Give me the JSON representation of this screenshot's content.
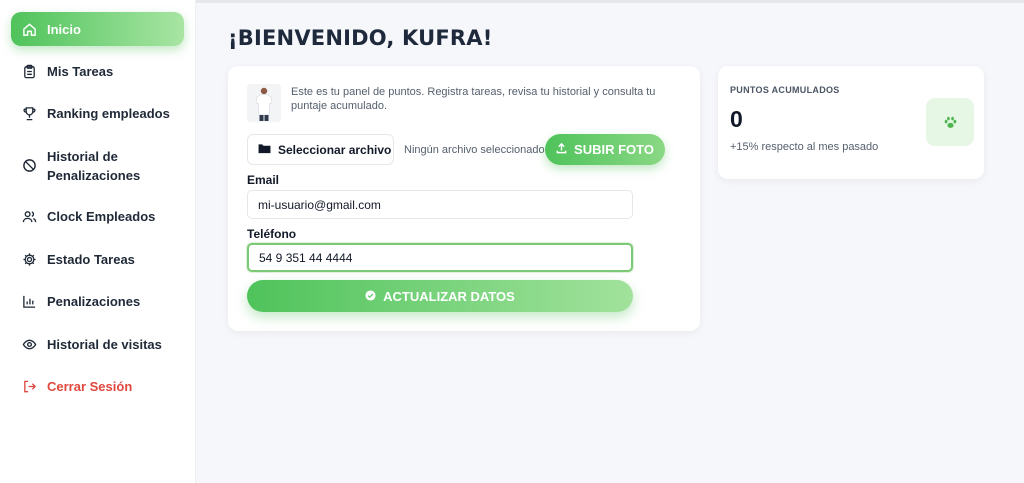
{
  "sidebar": {
    "items": [
      {
        "label": "Inicio",
        "icon": "home-icon"
      },
      {
        "label": "Mis Tareas",
        "icon": "clipboard-icon"
      },
      {
        "label": "Ranking empleados",
        "icon": "trophy-icon"
      },
      {
        "label": "Historial de Penalizaciones",
        "icon": "ban-icon"
      },
      {
        "label": "Clock Empleados",
        "icon": "users-icon"
      },
      {
        "label": "Estado Tareas",
        "icon": "gear-icon"
      },
      {
        "label": "Penalizaciones",
        "icon": "bar-chart-icon"
      },
      {
        "label": "Historial de visitas",
        "icon": "eye-icon"
      },
      {
        "label": "Cerrar Sesión",
        "icon": "logout-icon"
      }
    ],
    "active_index": 0
  },
  "main": {
    "title": "¡BIENVENIDO, KUFRA!",
    "intro": "Este es tu panel de puntos. Registra tareas, revisa tu historial y consulta tu puntaje acumulado.",
    "file_button_label": "Seleccionar archivo",
    "file_status": "Ningún archivo seleccionado",
    "upload_button_label": "SUBIR FOTO",
    "email_label": "Email",
    "email_value": "mi-usuario@gmail.com",
    "phone_label": "Teléfono",
    "phone_value": "54 9 351 44 4444",
    "update_button_label": "ACTUALIZAR DATOS"
  },
  "points": {
    "label": "PUNTOS ACUMULADOS",
    "value": "0",
    "trend": "+15% respecto al mes pasado",
    "icon": "paw-icon"
  },
  "colors": {
    "accent_green": "#4fc35b",
    "logout_red": "#e0483e",
    "page_bg": "#f6f7fb"
  }
}
